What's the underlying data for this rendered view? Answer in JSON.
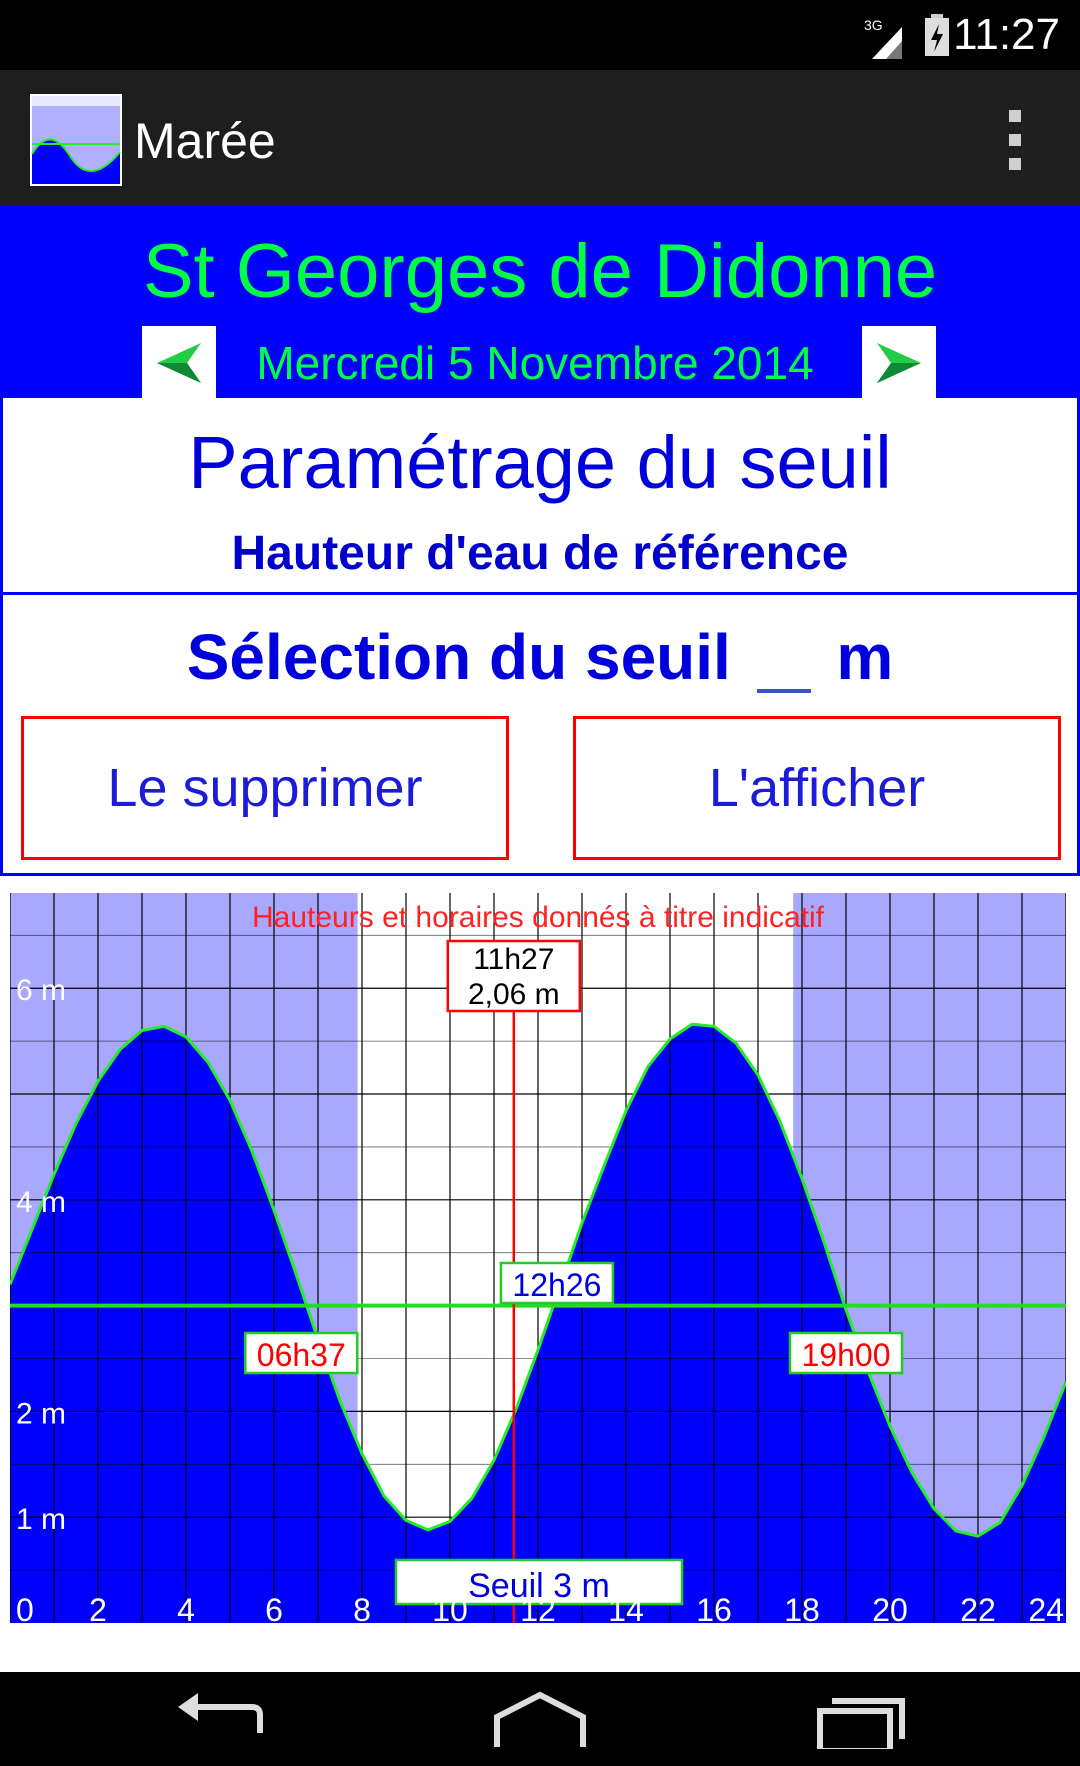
{
  "status_bar": {
    "network_label": "3G",
    "time": "11:27",
    "icons": [
      "signal-icon",
      "battery-icon"
    ]
  },
  "action_bar": {
    "title": "Marée",
    "icon": "app-tide-icon",
    "menu_icon": "overflow-menu-icon"
  },
  "header": {
    "location": "St Georges de Didonne",
    "date": "Mercredi 5 Novembre 2014",
    "prev_icon": "arrow-left-icon",
    "next_icon": "arrow-right-icon"
  },
  "param_panel": {
    "title": "Paramétrage du seuil",
    "subtitle": "Hauteur d'eau de référence",
    "selection_label": "Sélection du seuil",
    "selection_value": "",
    "selection_unit": "m",
    "delete_button": "Le supprimer",
    "show_button": "L'afficher"
  },
  "chart_data": {
    "type": "area",
    "title": "Hauteurs et horaires donnés à titre indicatif",
    "xlabel": "",
    "ylabel": "",
    "xlim": [
      0,
      24
    ],
    "ylim": [
      0,
      6.9
    ],
    "x_ticks": [
      "0",
      "2",
      "4",
      "6",
      "8",
      "10",
      "12",
      "14",
      "16",
      "18",
      "20",
      "22",
      "24"
    ],
    "y_ticks": [
      {
        "label": "1 m",
        "value": 1
      },
      {
        "label": "2 m",
        "value": 2
      },
      {
        "label": "4 m",
        "value": 4
      },
      {
        "label": "6 m",
        "value": 6
      }
    ],
    "grid": true,
    "night_periods": [
      [
        0,
        7.9
      ],
      [
        17.8,
        24
      ]
    ],
    "series": [
      {
        "x": [
          0,
          0.5,
          1,
          1.5,
          2,
          2.5,
          3,
          3.5,
          4,
          4.5,
          5,
          5.5,
          6,
          6.5,
          7,
          7.5,
          8,
          8.5,
          9,
          9.5,
          10,
          10.5,
          11,
          11.5,
          12,
          12.5,
          13,
          13.5,
          14,
          14.5,
          15,
          15.5,
          16,
          16.5,
          17,
          17.5,
          18,
          18.5,
          19,
          19.5,
          20,
          20.5,
          21,
          21.5,
          22,
          22.5,
          23,
          23.5,
          24
        ],
        "values": [
          3.2,
          3.72,
          4.24,
          4.72,
          5.12,
          5.42,
          5.6,
          5.64,
          5.54,
          5.3,
          4.94,
          4.46,
          3.9,
          3.3,
          2.68,
          2.1,
          1.6,
          1.2,
          0.97,
          0.88,
          0.96,
          1.18,
          1.54,
          2.02,
          2.58,
          3.18,
          3.78,
          4.32,
          4.84,
          5.26,
          5.52,
          5.66,
          5.64,
          5.48,
          5.18,
          4.74,
          4.2,
          3.6,
          2.96,
          2.38,
          1.86,
          1.42,
          1.08,
          0.87,
          0.82,
          0.95,
          1.3,
          1.76,
          2.28
        ]
      }
    ],
    "threshold": {
      "label": "Seuil",
      "value": "3 m",
      "level": 3.0
    },
    "threshold_crossings": [
      {
        "time": "06h37",
        "x": 6.62
      },
      {
        "time": "12h26",
        "x": 12.43
      },
      {
        "time": "19h00",
        "x": 19.0
      }
    ],
    "current": {
      "time": "11h27",
      "height": "2,06 m",
      "x": 11.45,
      "level": 2.06
    },
    "colors": {
      "tide_fill": "#0000ff",
      "tide_line": "#22ee22",
      "night_bg": "#a8a8ff",
      "day_bg": "#ffffff",
      "threshold_line": "#22dd22",
      "current_line": "#ff0000",
      "title_color": "#ff2222"
    }
  },
  "nav_bar": {
    "back_icon": "back-icon",
    "home_icon": "home-icon",
    "recents_icon": "recents-icon"
  }
}
